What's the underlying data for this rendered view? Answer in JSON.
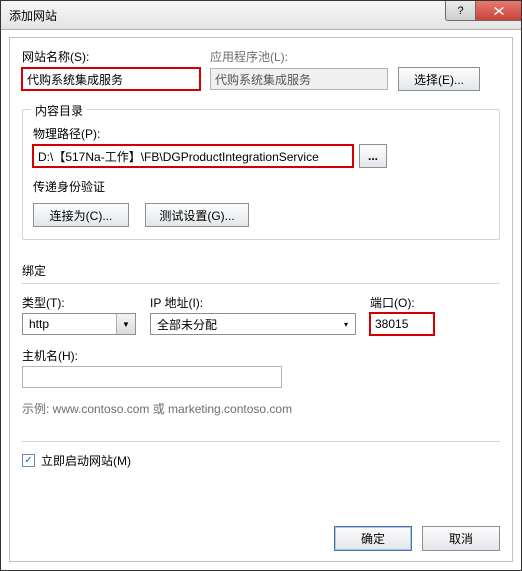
{
  "window": {
    "title": "添加网站"
  },
  "icons": {
    "help": "?",
    "close": "X",
    "browse": "...",
    "check": "✓",
    "arrow_down": "▼"
  },
  "top": {
    "site_name_label": "网站名称(S):",
    "site_name_value": "代购系统集成服务",
    "app_pool_label": "应用程序池(L):",
    "app_pool_value": "代购系统集成服务",
    "select_btn": "选择(E)..."
  },
  "content": {
    "group_label": "内容目录",
    "path_label": "物理路径(P):",
    "path_value": "D:\\【517Na-工作】\\FB\\DGProductIntegrationService",
    "auth_label": "传递身份验证",
    "connect_btn": "连接为(C)...",
    "test_btn": "测试设置(G)..."
  },
  "binding": {
    "group_label": "绑定",
    "type_label": "类型(T):",
    "type_value": "http",
    "ip_label": "IP 地址(I):",
    "ip_value": "全部未分配",
    "port_label": "端口(O):",
    "port_value": "38015",
    "host_label": "主机名(H):",
    "host_value": "",
    "example": "示例: www.contoso.com 或 marketing.contoso.com"
  },
  "start_now_label": "立即启动网站(M)",
  "footer": {
    "ok": "确定",
    "cancel": "取消"
  }
}
